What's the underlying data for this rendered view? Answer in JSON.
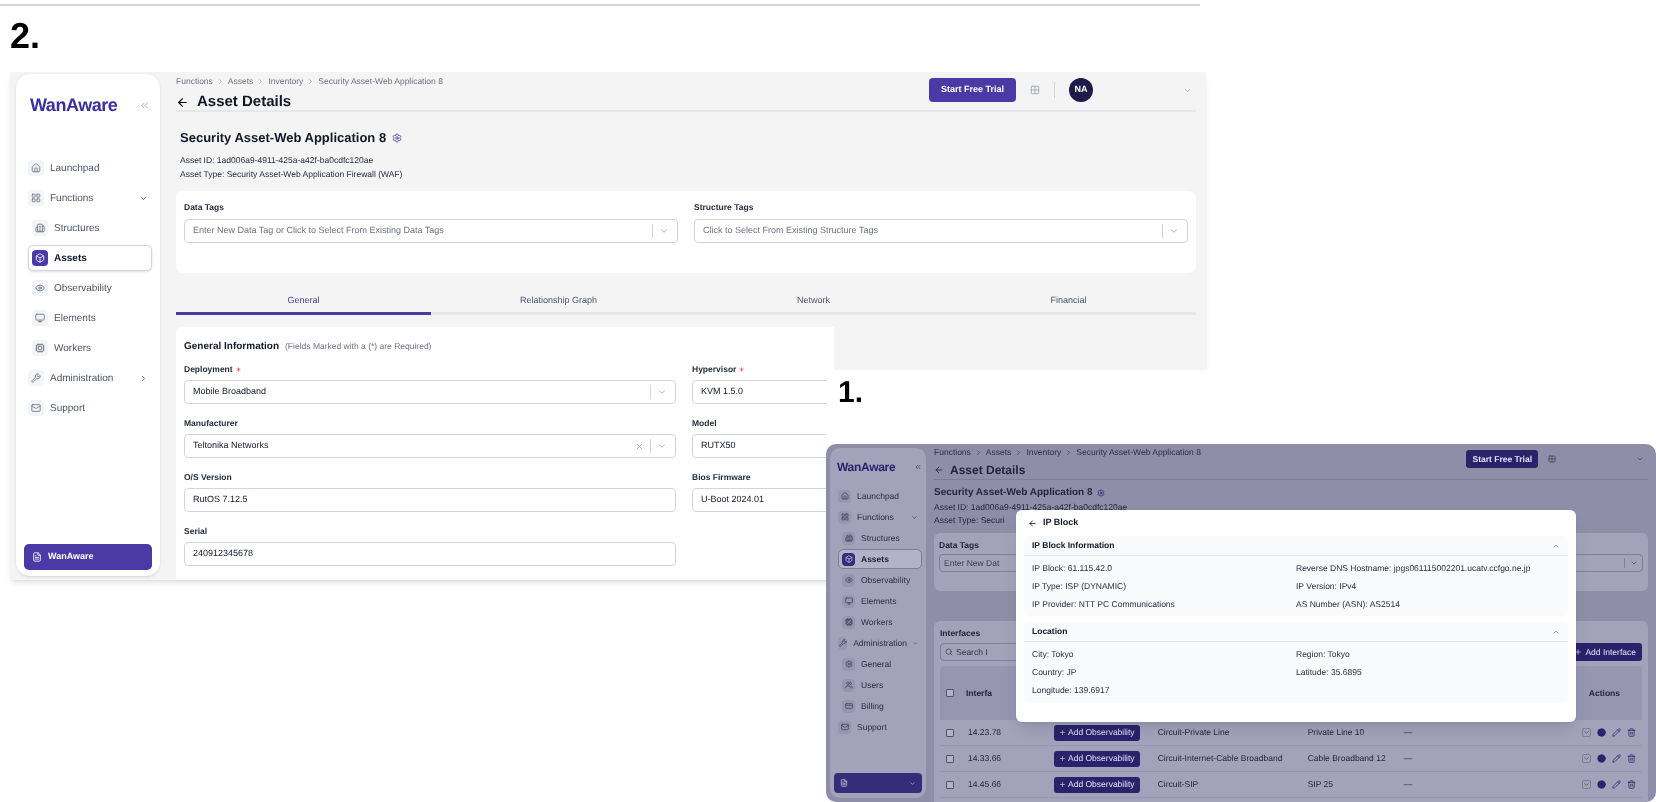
{
  "asset_details_view": {
    "number": "2.",
    "sidebar": {
      "logo": "WanAware",
      "items": [
        {
          "label": "Launchpad",
          "selected": false
        },
        {
          "label": "Functions",
          "selected": false,
          "expanded": true,
          "children": [
            {
              "label": "Structures",
              "selected": false
            },
            {
              "label": "Assets",
              "selected": true
            },
            {
              "label": "Observability",
              "selected": false
            },
            {
              "label": "Elements",
              "selected": false
            },
            {
              "label": "Workers",
              "selected": false
            }
          ]
        },
        {
          "label": "Administration",
          "selected": false,
          "expanded": false
        },
        {
          "label": "Support",
          "selected": false
        }
      ],
      "footer_button": "WanAware"
    },
    "breadcrumb": [
      "Functions",
      "Assets",
      "Inventory",
      "Security Asset-Web Application 8"
    ],
    "page_title": "Asset Details",
    "trial_button": "Start Free Trial",
    "avatar": "NA",
    "asset": {
      "title": "Security Asset-Web Application 8",
      "id_label": "Asset ID:",
      "id": "1ad006a9-4911-425a-a42f-ba0cdfc120ae",
      "type_label": "Asset Type:",
      "type": "Security Asset-Web Application Firewall (WAF)"
    },
    "tags": [
      {
        "label": "Data Tags",
        "placeholder": "Enter New Data Tag or Click to Select From Existing Data Tags"
      },
      {
        "label": "Structure Tags",
        "placeholder": "Click to Select From Existing Structure Tags"
      }
    ],
    "tabs": [
      {
        "label": "General",
        "selected": true
      },
      {
        "label": "Relationship Graph",
        "selected": false
      },
      {
        "label": "Network",
        "selected": false
      },
      {
        "label": "Financial",
        "selected": false
      }
    ],
    "general": {
      "title": "General Information",
      "note": "(Fields Marked with a (*) are Required)",
      "columns": [
        [
          {
            "label": "Deployment",
            "required": true,
            "kind": "select",
            "value": "Mobile Broadband",
            "clearable": false
          },
          {
            "label": "Manufacturer",
            "required": false,
            "kind": "select",
            "value": "Teltonika Networks",
            "clearable": true
          },
          {
            "label": "O/S Version",
            "required": false,
            "kind": "text",
            "value": "RutOS 7.12.5"
          },
          {
            "label": "Serial",
            "required": false,
            "kind": "text",
            "value": "240912345678"
          }
        ],
        [
          {
            "label": "Hypervisor",
            "required": true,
            "kind": "text",
            "value": "KVM 1.5.0"
          },
          {
            "label": "Model",
            "required": false,
            "kind": "text",
            "value": "RUTX50"
          },
          {
            "label": "Bios Firmware",
            "required": false,
            "kind": "text",
            "value": "U-Boot 2024.01"
          }
        ]
      ]
    }
  },
  "ip_block_view": {
    "number": "1.",
    "sidebar": {
      "logo": "WanAware",
      "items": [
        {
          "label": "Launchpad",
          "selected": false
        },
        {
          "label": "Functions",
          "selected": false,
          "expanded": true,
          "children": [
            {
              "label": "Structures",
              "selected": false
            },
            {
              "label": "Assets",
              "selected": true
            },
            {
              "label": "Observability",
              "selected": false
            },
            {
              "label": "Elements",
              "selected": false
            },
            {
              "label": "Workers",
              "selected": false
            }
          ]
        },
        {
          "label": "Administration",
          "selected": false,
          "expanded": true,
          "children": [
            {
              "label": "General",
              "selected": false
            },
            {
              "label": "Users",
              "selected": false
            },
            {
              "label": "Billing",
              "selected": false
            }
          ]
        },
        {
          "label": "Support",
          "selected": false
        }
      ]
    },
    "breadcrumb": [
      "Functions",
      "Assets",
      "Inventory",
      "Security Asset-Web Application 8"
    ],
    "page_title": "Asset Details",
    "trial_button": "Start Free Trial",
    "asset": {
      "title": "Security Asset-Web Application 8",
      "id_label": "Asset ID:",
      "id": "1ad006a9-4911-425a-a42f-ba0cdfc120ae",
      "type_label": "Asset Type:",
      "type": "Securi"
    },
    "data_tags": {
      "label": "Data Tags",
      "placeholder": "Enter New Dat"
    },
    "interfaces": {
      "title": "Interfaces",
      "search_placeholder": "Search I",
      "add_button": "Add Interface",
      "columns": [
        "Interfa",
        "Actions"
      ],
      "header_checked": false,
      "rows": [
        {
          "checked": false,
          "interface": "14.23.78",
          "observability_button": "Add Observability",
          "circuit": "Circuit-Private Line",
          "name": "Private Line 10",
          "column_5": "—"
        },
        {
          "checked": false,
          "interface": "14.33.66",
          "observability_button": "Add Observability",
          "circuit": "Circuit-Internet-Cable Broadband",
          "name": "Cable Broadband 12",
          "column_5": "—"
        },
        {
          "checked": false,
          "interface": "14.45.66",
          "observability_button": "Add Observability",
          "circuit": "Circuit-SIP",
          "name": "SIP 25",
          "column_5": "—"
        }
      ]
    },
    "modal": {
      "title": "IP Block",
      "sections": [
        {
          "title": "IP Block Information",
          "expanded": true,
          "items": [
            {
              "label": "IP Block:",
              "value": "61.115.42.0"
            },
            {
              "label": "Reverse DNS Hostname:",
              "value": "jpgs061115002201.ucatv.ccfgo.ne.jp"
            },
            {
              "label": "IP Type:",
              "value": "ISP (DYNAMIC)"
            },
            {
              "label": "IP Version:",
              "value": "IPv4"
            },
            {
              "label": "IP Provider:",
              "value": "NTT PC Communications"
            },
            {
              "label": "AS Number (ASN):",
              "value": "AS2514"
            }
          ]
        },
        {
          "title": "Location",
          "expanded": true,
          "items": [
            {
              "label": "City:",
              "value": "Tokyo"
            },
            {
              "label": "Region:",
              "value": "Tokyo"
            },
            {
              "label": "Country:",
              "value": "JP"
            },
            {
              "label": "Latitude:",
              "value": "35.6895"
            },
            {
              "label": "Longitude:",
              "value": "139.6917"
            }
          ]
        }
      ]
    }
  }
}
